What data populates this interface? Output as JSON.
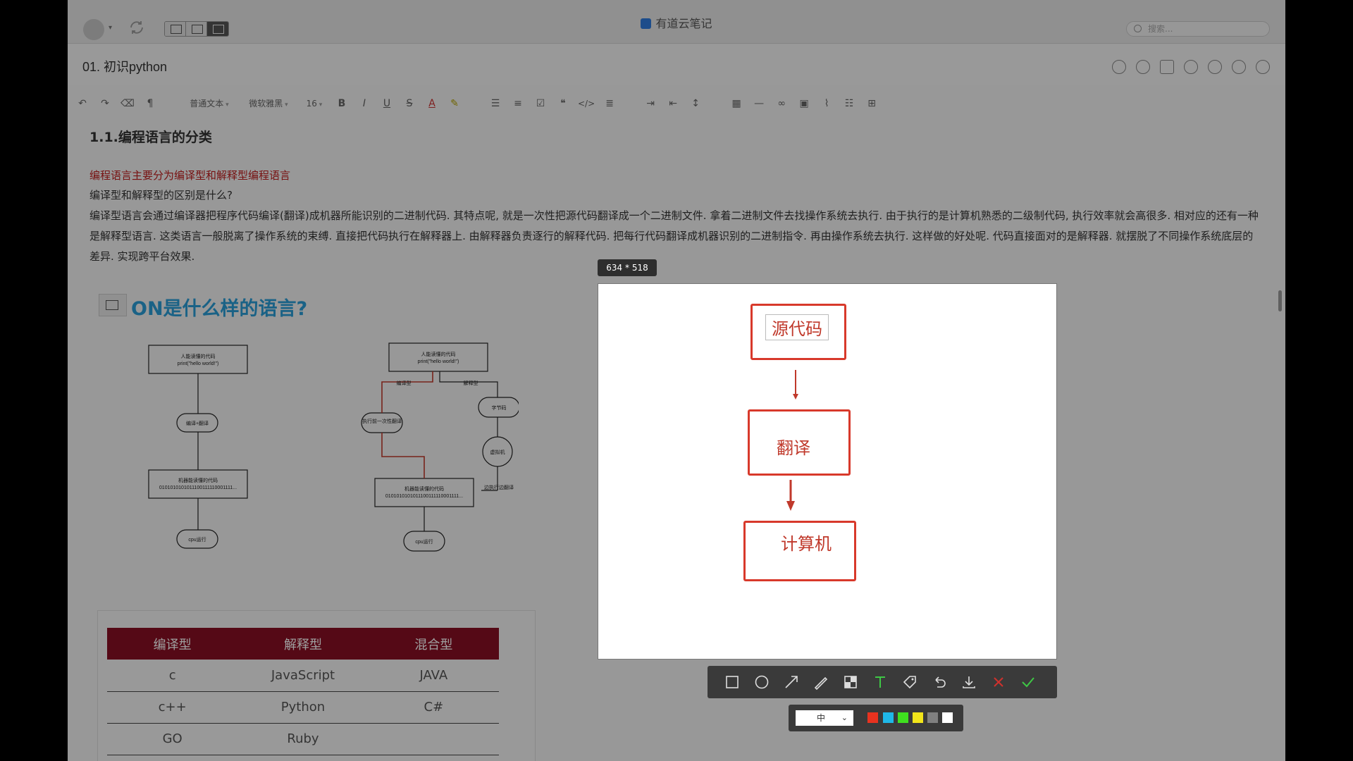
{
  "app": {
    "title": "有道云笔记",
    "search_placeholder": "搜索..."
  },
  "note": {
    "title": "01. 初识python"
  },
  "toolbar": {
    "text_style": "普通文本",
    "font_family": "微软雅黑",
    "font_size": "16"
  },
  "content": {
    "heading": "1.1.编程语言的分类",
    "red_line": "编程语言主要分为编译型和解释型编程语言",
    "question": "编译型和解释型的区别是什么?",
    "paragraph": "编译型语言会通过编译器把程序代码编译(翻译)成机器所能识别的二进制代码. 其特点呢, 就是一次性把源代码翻译成一个二进制文件. 拿着二进制文件去找操作系统去执行. 由于执行的是计算机熟悉的二级制代码, 执行效率就会高很多. 相对应的还有一种是解释型语言. 这类语言一般脱离了操作系统的束缚. 直接把代码执行在解释器上. 由解释器负责逐行的解释代码. 把每行代码翻译成机器识别的二进制指令. 再由操作系统去执行. 这样做的好处呢. 代码直接面对的是解释器. 就摆脱了不同操作系统底层的差异. 实现跨平台效果.",
    "image_title": "ON是什么样的语言?"
  },
  "flowchart": {
    "left": {
      "source": "人能读懂的代码",
      "source_code": "print(\"hello world!\")",
      "compile": "编译+翻译",
      "machine": "机器能读懂的代码",
      "binary": "0101010101011100111110001111...",
      "run": "cpu运行"
    },
    "right": {
      "source": "人能读懂的代码",
      "source_code": "print(\"hello world!\")",
      "branch_compiled": "编译型",
      "branch_interpreted": "解释型",
      "translate_once": "执行前一次性翻译",
      "bytecode": "字节码",
      "vm": "虚拟机",
      "machine": "机器能读懂的代码",
      "binary": "0101010101011100111110001111...",
      "line_by_line": "边执行边翻译",
      "run": "cpu运行"
    }
  },
  "table": {
    "headers": [
      "编译型",
      "解释型",
      "混合型"
    ],
    "rows": [
      [
        "c",
        "JavaScript",
        "JAVA"
      ],
      [
        "c++",
        "Python",
        "C#"
      ],
      [
        "GO",
        "Ruby",
        ""
      ]
    ]
  },
  "capture": {
    "size_label": "634 * 518",
    "box1": "源代码",
    "box2": "翻译",
    "box3": "计算机",
    "size_option": "中",
    "colors": [
      "#e8321f",
      "#1fb8e8",
      "#3fe01f",
      "#f2e51a",
      "#808080",
      "#ffffff"
    ],
    "accent_check": "#3ec845",
    "accent_cancel": "#d0312d"
  }
}
